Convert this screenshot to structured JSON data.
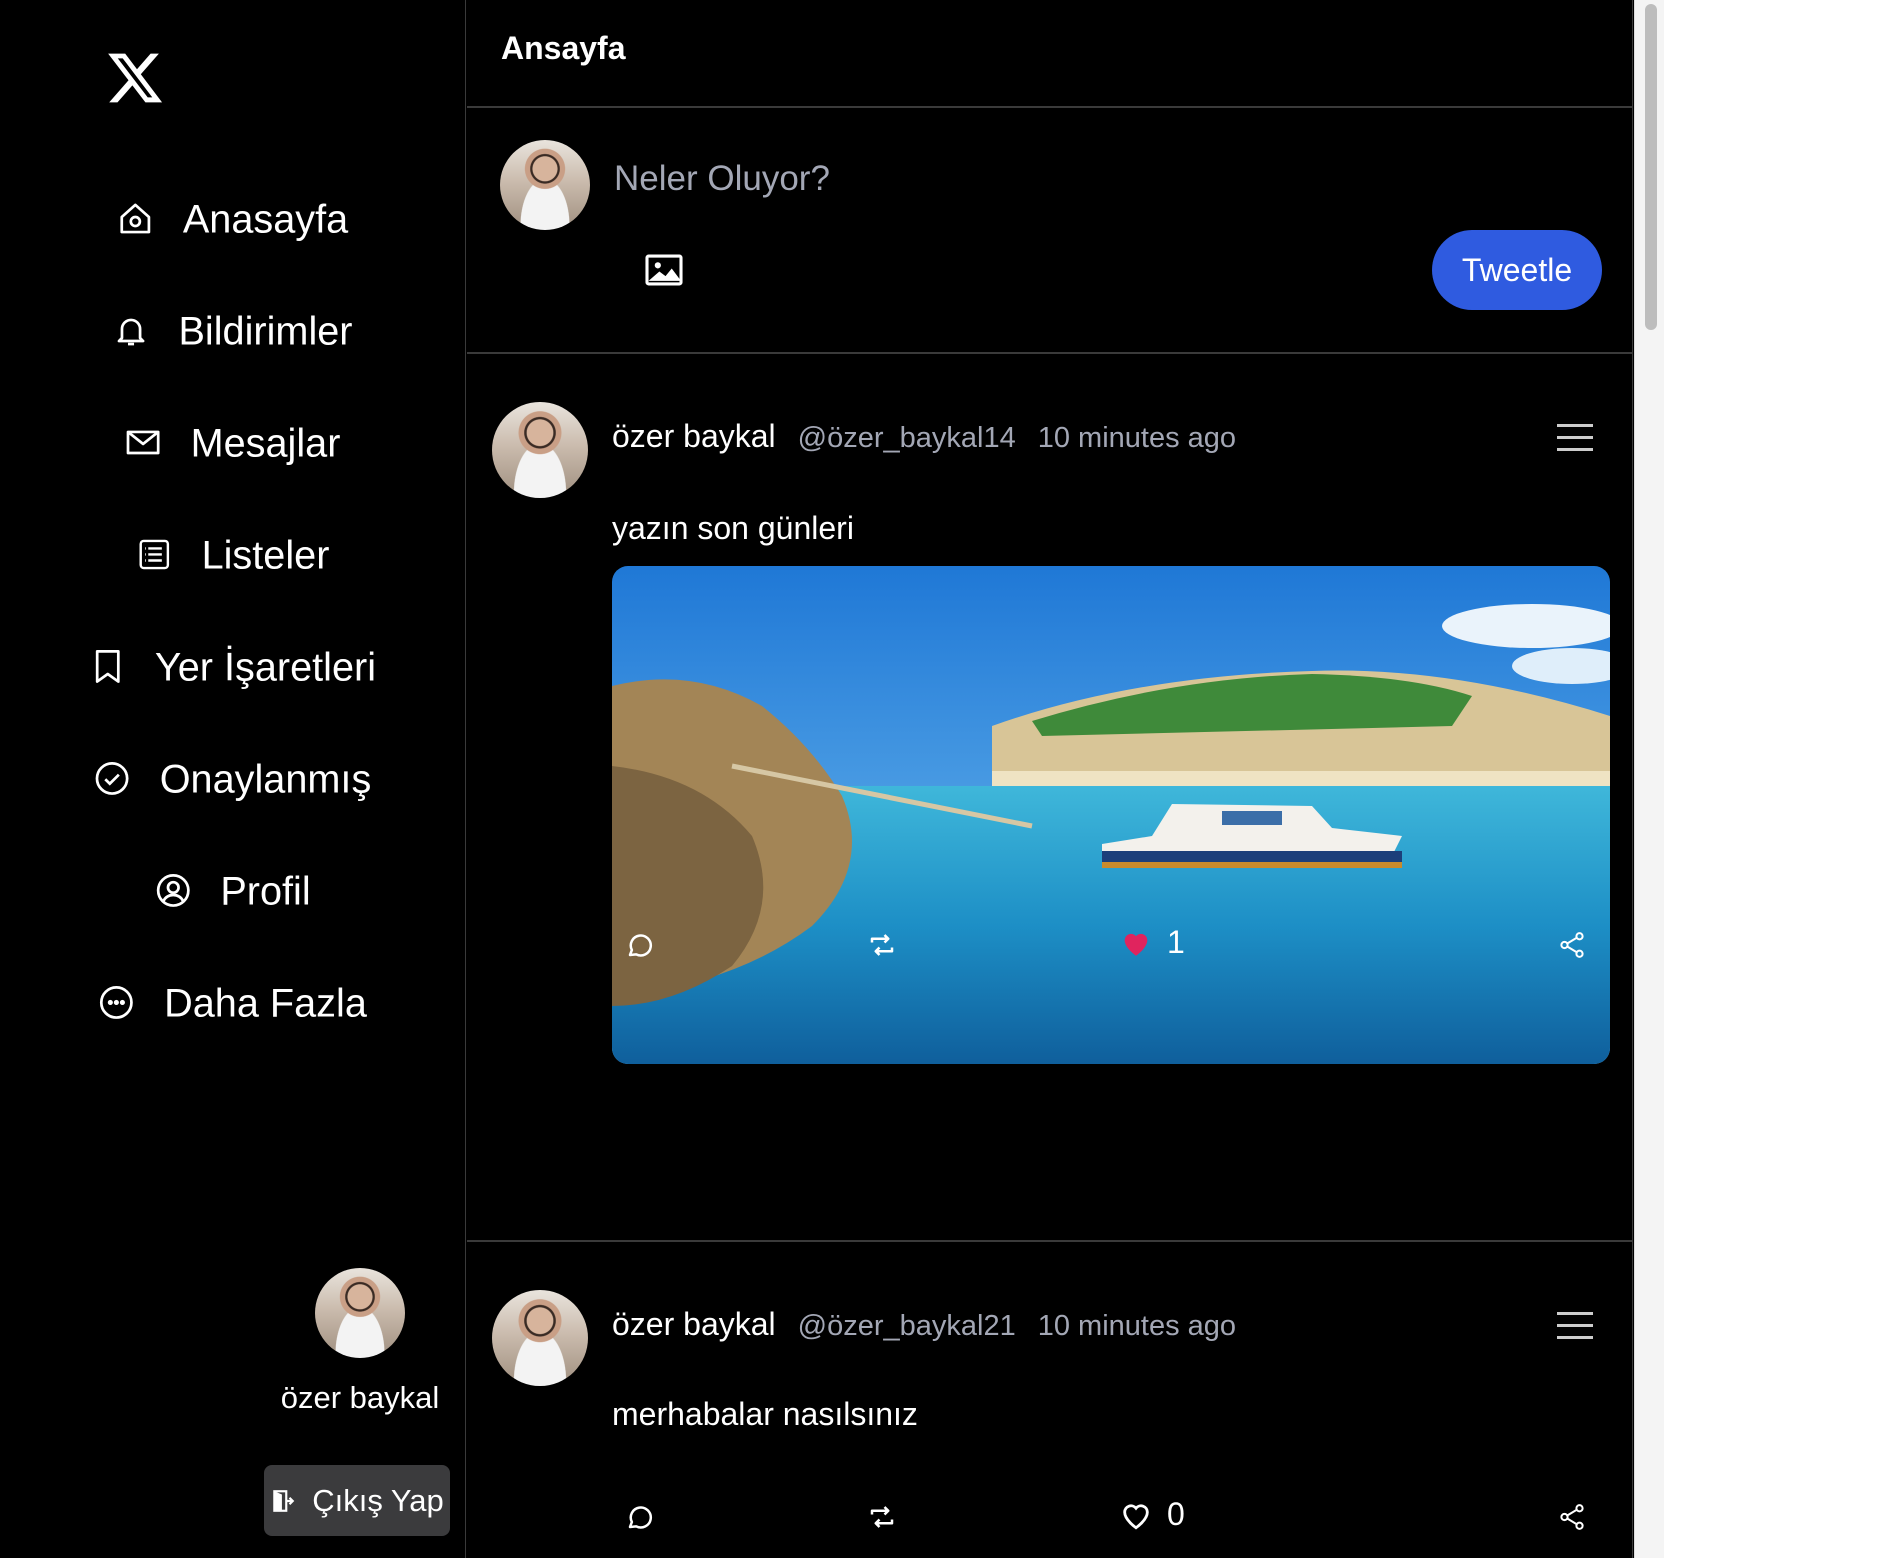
{
  "app": {
    "logo_icon": "x-logo-icon"
  },
  "sidebar": {
    "items": [
      {
        "label": "Anasayfa",
        "icon": "home-icon"
      },
      {
        "label": "Bildirimler",
        "icon": "bell-icon"
      },
      {
        "label": "Mesajlar",
        "icon": "mail-icon"
      },
      {
        "label": "Listeler",
        "icon": "list-icon"
      },
      {
        "label": "Yer İşaretleri",
        "icon": "bookmark-icon"
      },
      {
        "label": "Onaylanmış",
        "icon": "check-circle-icon"
      },
      {
        "label": "Profil",
        "icon": "user-circle-icon"
      },
      {
        "label": "Daha Fazla",
        "icon": "more-circle-icon"
      }
    ],
    "user": {
      "name": "özer baykal"
    },
    "logout_label": "Çıkış Yap"
  },
  "header": {
    "title": "Ansayfa"
  },
  "compose": {
    "placeholder": "Neler Oluyor?",
    "submit_label": "Tweetle"
  },
  "tweets": [
    {
      "name": "özer baykal",
      "handle": "@özer_baykal14",
      "time": "10 minutes ago",
      "text": "yazın son günleri",
      "has_image": true,
      "liked": true,
      "like_count": "1"
    },
    {
      "name": "özer baykal",
      "handle": "@özer_baykal21",
      "time": "10 minutes ago",
      "text": "merhabalar nasılsınız",
      "has_image": false,
      "liked": false,
      "like_count": "0"
    }
  ],
  "colors": {
    "accent": "#2f5be0",
    "like": "#e0245e",
    "muted": "#a3a7b5",
    "border": "#3a3a3a"
  }
}
